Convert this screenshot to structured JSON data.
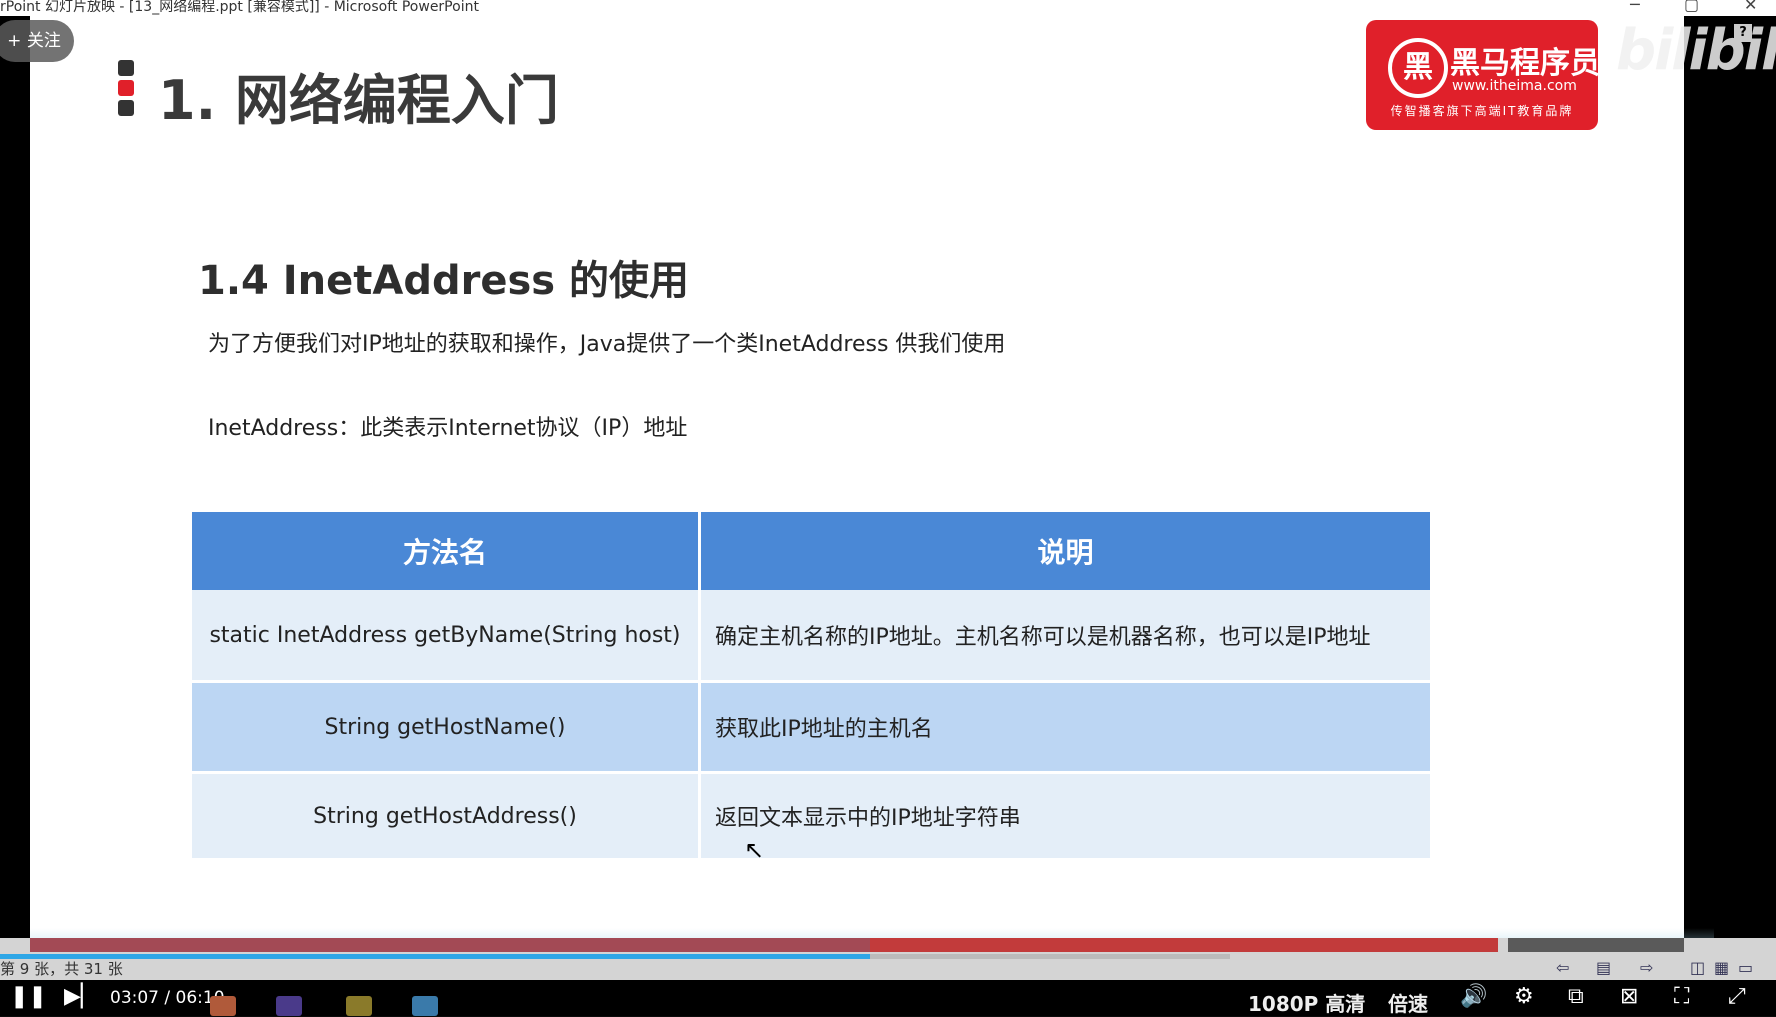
{
  "window": {
    "title": "rPoint 幻灯片放映 - [13_网络编程.ppt [兼容模式]] - Microsoft PowerPoint",
    "minimize": "─",
    "restore": "▢",
    "close": "✕"
  },
  "overlay": {
    "follow_label": "+ 关注",
    "bili_logo": "bilibili",
    "help": "?"
  },
  "slide": {
    "heading": "1. 网络编程入门",
    "brand": {
      "circle": "黑",
      "name": "黑马程序员",
      "url": "www.itheima.com",
      "tagline": "传智播客旗下高端IT教育品牌"
    },
    "section_title": "1.4 InetAddress 的使用",
    "intro": "为了方便我们对IP地址的获取和操作，Java提供了一个类InetAddress 供我们使用",
    "definition": "InetAddress：此类表示Internet协议（IP）地址",
    "table": {
      "headers": [
        "方法名",
        "说明"
      ],
      "rows": [
        {
          "method": "static InetAddress getByName(String host)",
          "desc": "确定主机名称的IP地址。主机名称可以是机器名称，也可以是IP地址"
        },
        {
          "method": "String getHostName()",
          "desc": "获取此IP地址的主机名"
        },
        {
          "method": "String getHostAddress()",
          "desc": "返回文本显示中的IP地址字符串"
        }
      ]
    }
  },
  "ppt_status": {
    "slide_count": "第 9 张，共 31 张"
  },
  "player": {
    "current_time": "03:07",
    "separator": "/",
    "total_time": "06:10",
    "quality": "1080P 高清",
    "speed": "倍速",
    "progress_fraction": 0.49
  },
  "colors": {
    "table_header": "#4a88d6",
    "row_light": "#e4eef8",
    "row_mid": "#bcd6f3",
    "brand_red": "#e0202a",
    "progress_blue": "#2ea6e6"
  }
}
